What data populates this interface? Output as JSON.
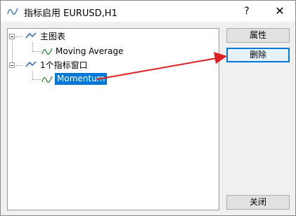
{
  "window": {
    "title": "指标启用 EURUSD,H1",
    "help_label": "?",
    "close_label": "✕"
  },
  "tree": {
    "main_chart": {
      "label": "主图表",
      "children": [
        {
          "label": "Moving Average"
        }
      ]
    },
    "indicator_window": {
      "label": "1个指标窗口",
      "children": [
        {
          "label": "Momentum",
          "selected": true
        }
      ]
    }
  },
  "buttons": {
    "properties": "属性",
    "delete": "删除",
    "close": "关闭"
  },
  "colors": {
    "selection": "#0078d7",
    "annotation_arrow": "#e02020"
  },
  "icons": [
    "indicator-app-icon",
    "chart-icon",
    "indicator-icon"
  ]
}
